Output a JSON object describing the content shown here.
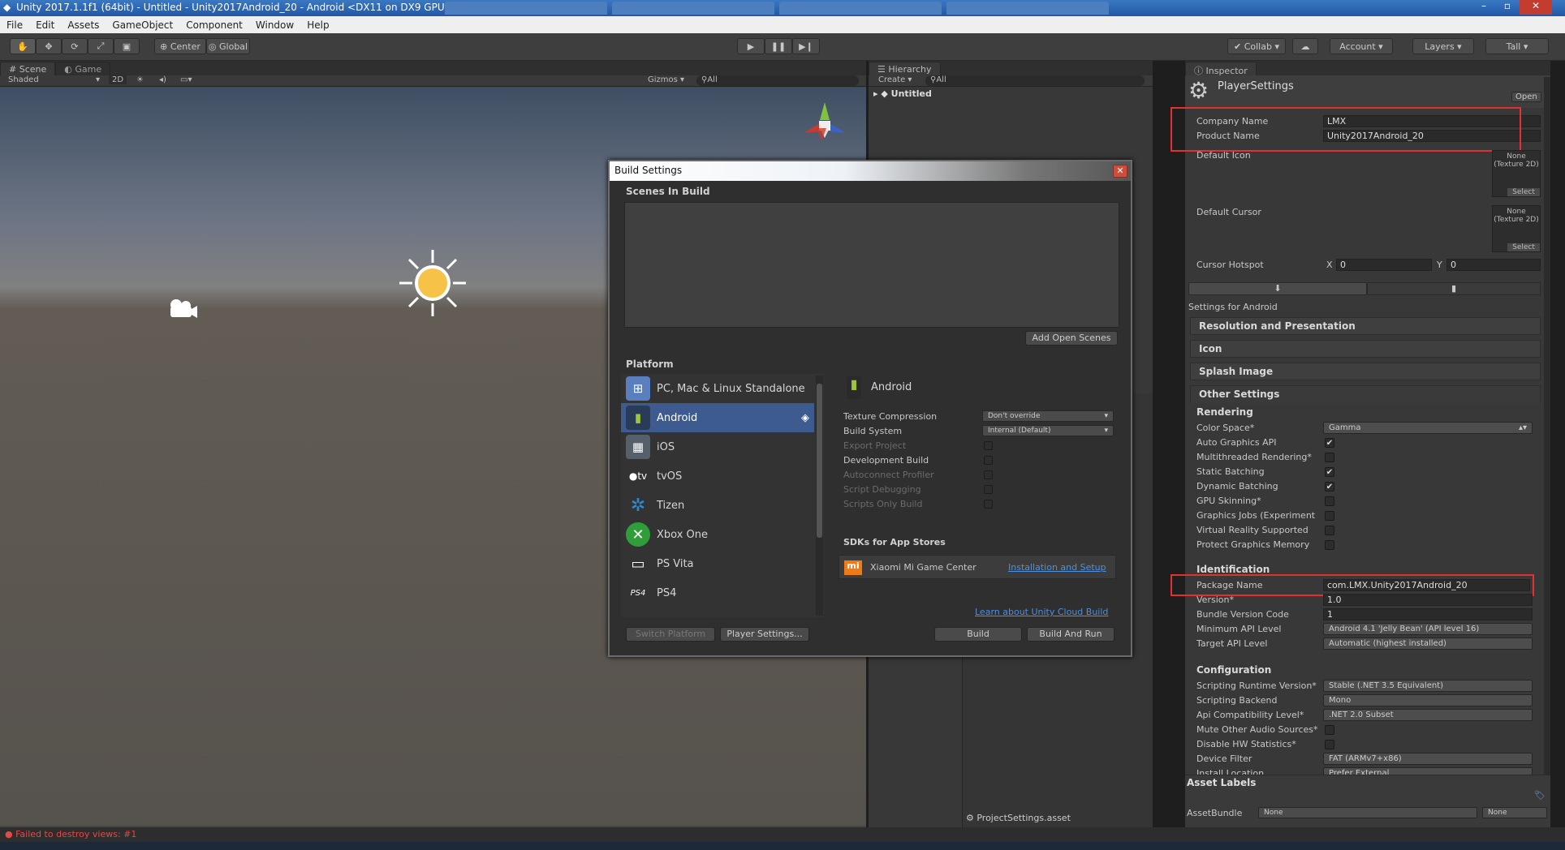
{
  "window": {
    "title": "Unity 2017.1.1f1 (64bit) - Untitled - Unity2017Android_20 - Android <DX11 on DX9 GPU>",
    "controls": [
      "–",
      "▫",
      "✕"
    ]
  },
  "menubar": [
    "File",
    "Edit",
    "Assets",
    "GameObject",
    "Component",
    "Window",
    "Help"
  ],
  "toolbar": {
    "center": "Center",
    "global": "Global",
    "collab": "Collab",
    "account": "Account",
    "layers": "Layers",
    "layout": "Tall"
  },
  "scene": {
    "tab_scene": "Scene",
    "tab_game": "Game",
    "shaded": "Shaded",
    "mode_2d": "2D",
    "gizmos": "Gizmos",
    "search": "All"
  },
  "hierarchy": {
    "tab": "Hierarchy",
    "create": "Create",
    "search": "All",
    "root": "Untitled",
    "project_asset": "ProjectSettings.asset"
  },
  "inspector": {
    "tab": "Inspector",
    "title": "PlayerSettings",
    "open": "Open",
    "company_name_label": "Company Name",
    "company_name": "LMX",
    "product_name_label": "Product Name",
    "product_name": "Unity2017Android_20",
    "default_icon_label": "Default Icon",
    "default_cursor_label": "Default Cursor",
    "none_texture": "None (Texture 2D)",
    "select": "Select",
    "cursor_hotspot_label": "Cursor Hotspot",
    "hotspot_x_label": "X",
    "hotspot_x": "0",
    "hotspot_y_label": "Y",
    "hotspot_y": "0",
    "settings_for": "Settings for Android",
    "sections": [
      "Resolution and Presentation",
      "Icon",
      "Splash Image",
      "Other Settings"
    ],
    "rendering_header": "Rendering",
    "color_space_label": "Color Space*",
    "color_space": "Gamma",
    "checks": [
      {
        "label": "Auto Graphics API",
        "checked": true
      },
      {
        "label": "Multithreaded Rendering*",
        "checked": false
      },
      {
        "label": "Static Batching",
        "checked": true
      },
      {
        "label": "Dynamic Batching",
        "checked": true
      },
      {
        "label": "GPU Skinning*",
        "checked": false
      },
      {
        "label": "Graphics Jobs (Experiment",
        "checked": false
      },
      {
        "label": "Virtual Reality Supported",
        "checked": false
      },
      {
        "label": "Protect Graphics Memory",
        "checked": false
      }
    ],
    "identification_header": "Identification",
    "package_name_label": "Package Name",
    "package_name": "com.LMX.Unity2017Android_20",
    "version_label": "Version*",
    "version": "1.0",
    "bundle_version_code_label": "Bundle Version Code",
    "bundle_version_code": "1",
    "min_api_label": "Minimum API Level",
    "min_api": "Android 4.1 'Jelly Bean' (API level 16)",
    "target_api_label": "Target API Level",
    "target_api": "Automatic (highest installed)",
    "configuration_header": "Configuration",
    "scripting_runtime_label": "Scripting Runtime Version*",
    "scripting_runtime": "Stable (.NET 3.5 Equivalent)",
    "scripting_backend_label": "Scripting Backend",
    "scripting_backend": "Mono",
    "api_compat_label": "Api Compatibility Level*",
    "api_compat": ".NET 2.0 Subset",
    "mute_audio_label": "Mute Other Audio Sources*",
    "disable_hw_label": "Disable HW Statistics*",
    "device_filter_label": "Device Filter",
    "device_filter": "FAT (ARMv7+x86)",
    "install_location_label": "Install Location",
    "install_location": "Prefer External",
    "asset_labels": "Asset Labels",
    "assetbundle_label": "AssetBundle",
    "assetbundle": "None",
    "assetbundle_variant": "None"
  },
  "build_settings": {
    "title": "Build Settings",
    "scenes_header": "Scenes In Build",
    "add_open_scenes": "Add Open Scenes",
    "platform_header": "Platform",
    "platforms": [
      {
        "name": "PC, Mac & Linux Standalone",
        "icon": "pc-icon",
        "color": "#5a7fbf"
      },
      {
        "name": "Android",
        "icon": "android-icon",
        "color": "#9fc53a"
      },
      {
        "name": "iOS",
        "icon": "ios-icon",
        "color": "#7a8a9a"
      },
      {
        "name": "tvOS",
        "icon": "tvos-icon",
        "color": "#dddddd"
      },
      {
        "name": "Tizen",
        "icon": "tizen-icon",
        "color": "#2b8ad6"
      },
      {
        "name": "Xbox One",
        "icon": "xbox-icon",
        "color": "#2f9e3a"
      },
      {
        "name": "PS Vita",
        "icon": "psvita-icon",
        "color": "#dddddd"
      },
      {
        "name": "PS4",
        "icon": "ps4-icon",
        "color": "#dddddd"
      }
    ],
    "selected_platform": "Android",
    "texture_compression_label": "Texture Compression",
    "texture_compression": "Don't override",
    "build_system_label": "Build System",
    "build_system": "Internal (Default)",
    "export_project": "Export Project",
    "development_build": "Development Build",
    "autoconnect_profiler": "Autoconnect Profiler",
    "script_debugging": "Script Debugging",
    "scripts_only_build": "Scripts Only Build",
    "sdks_header": "SDKs for App Stores",
    "xiaomi": "Xiaomi Mi Game Center",
    "installation_setup": "Installation and Setup",
    "cloud_build": "Learn about Unity Cloud Build",
    "switch_platform": "Switch Platform",
    "player_settings": "Player Settings...",
    "build": "Build",
    "build_and_run": "Build And Run"
  },
  "status": {
    "error": "Failed to destroy views: #1"
  },
  "colors": {
    "accent_blue": "#3d5b8e",
    "highlight_red": "#e33030",
    "link": "#4d8fe0"
  }
}
